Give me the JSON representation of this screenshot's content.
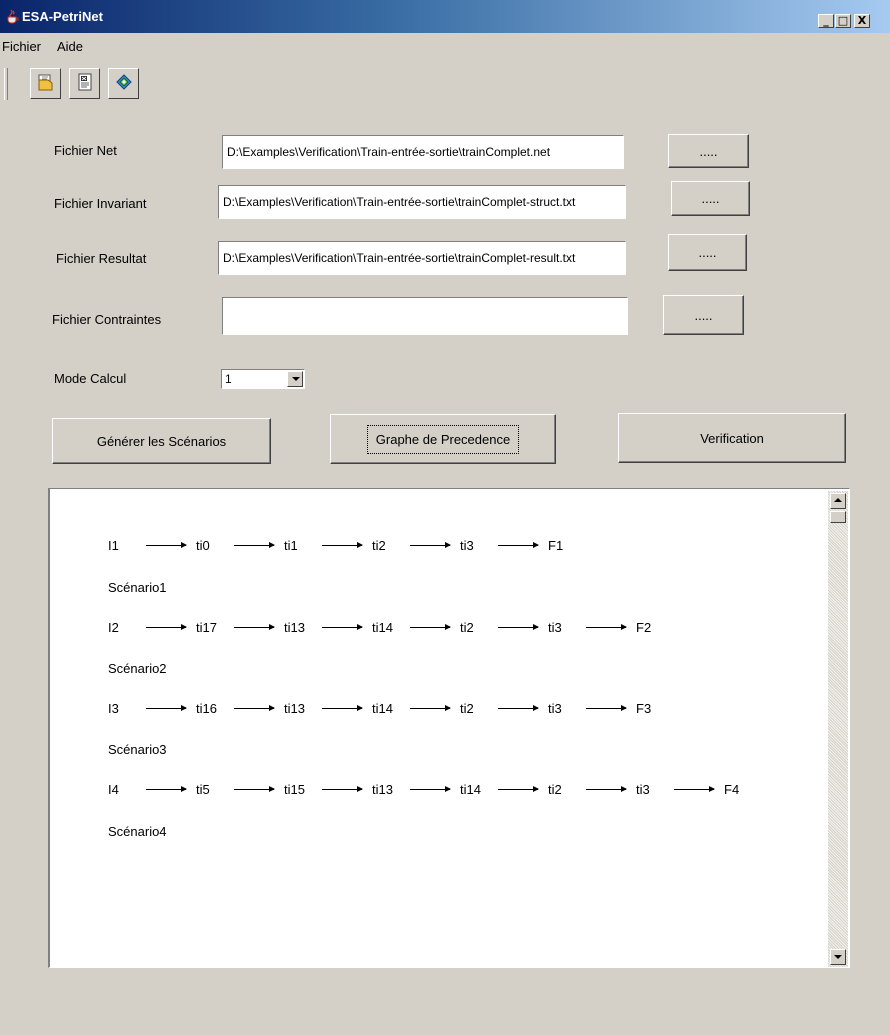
{
  "window": {
    "title": "ESA-PetriNet",
    "minimize": "_",
    "maximize": "□",
    "close": "X"
  },
  "menu": {
    "items": [
      "Fichier",
      "Aide"
    ]
  },
  "toolbar": {
    "buttons": [
      "open-file-icon",
      "export-icon",
      "help-book-icon"
    ]
  },
  "form": {
    "net": {
      "label": "Fichier Net",
      "value": "D:\\Examples\\Verification\\Train-entrée-sortie\\trainComplet.net",
      "browse": "....."
    },
    "invariant": {
      "label": "Fichier Invariant",
      "value": "D:\\Examples\\Verification\\Train-entrée-sortie\\trainComplet-struct.txt",
      "browse": "....."
    },
    "resultat": {
      "label": "Fichier Resultat",
      "value": "D:\\Examples\\Verification\\Train-entrée-sortie\\trainComplet-result.txt",
      "browse": "....."
    },
    "contraintes": {
      "label": "Fichier Contraintes",
      "value": "",
      "browse": "....."
    },
    "mode": {
      "label": "Mode Calcul",
      "value": "1"
    }
  },
  "actions": {
    "generate": "Générer les Scénarios",
    "graph": "Graphe de Precedence",
    "verify": "Verification"
  },
  "scenarios": [
    {
      "name": "Scénario1",
      "path": [
        "I1",
        "ti0",
        "ti1",
        "ti2",
        "ti3",
        "F1"
      ]
    },
    {
      "name": "Scénario2",
      "path": [
        "I2",
        "ti17",
        "ti13",
        "ti14",
        "ti2",
        "ti3",
        "F2"
      ]
    },
    {
      "name": "Scénario3",
      "path": [
        "I3",
        "ti16",
        "ti13",
        "ti14",
        "ti2",
        "ti3",
        "F3"
      ]
    },
    {
      "name": "Scénario4",
      "path": [
        "I4",
        "ti5",
        "ti15",
        "ti13",
        "ti14",
        "ti2",
        "ti3",
        "F4"
      ]
    }
  ]
}
